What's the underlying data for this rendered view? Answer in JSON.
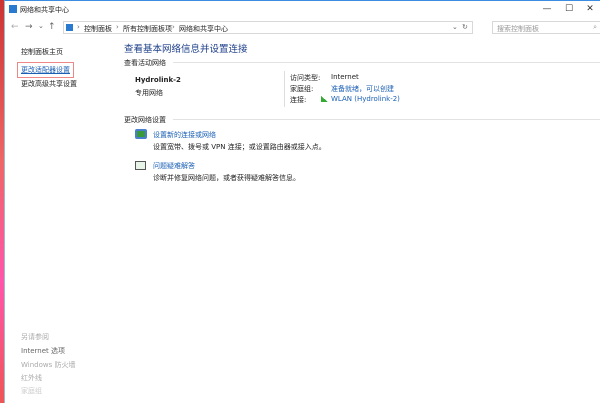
{
  "window": {
    "title": "网络和共享中心",
    "minimize": "—",
    "maximize": "☐",
    "close": "✕"
  },
  "nav": {
    "back": "←",
    "forward": "→",
    "recent": "⌄",
    "up": "↑",
    "refresh": "↻",
    "dropdown": "⌄",
    "breadcrumb": [
      "控制面板",
      "所有控制面板项",
      "网络和共享中心"
    ],
    "sep": "›",
    "search_placeholder": "搜索控制面板",
    "search_icon": "⌕"
  },
  "sidebar": {
    "items": [
      "控制面板主页",
      "更改适配器设置",
      "更改高级共享设置"
    ],
    "see_also_title": "另请参阅",
    "see_also": [
      "Internet 选项",
      "Windows 防火墙",
      "红外线",
      "家庭组"
    ]
  },
  "main": {
    "heading": "查看基本网络信息并设置连接",
    "active_section": "查看活动网络",
    "network": {
      "name": "Hydrolink-2",
      "type": "专用网络",
      "access_label": "访问类型:",
      "access_value": "Internet",
      "homegroup_label": "家庭组:",
      "homegroup_value": "准备就绪，可以创建",
      "conn_label": "连接:",
      "conn_value": "WLAN (Hydrolink-2)"
    },
    "change_section": "更改网络设置",
    "tasks": [
      {
        "link": "设置新的连接或网络",
        "desc": "设置宽带、拨号或 VPN 连接；或设置路由器或接入点。"
      },
      {
        "link": "问题疑难解答",
        "desc": "诊断并修复网络问题，或者获得疑难解答信息。"
      }
    ]
  },
  "colors": {
    "link": "#1a5fb4",
    "highlight_box": "#e88"
  }
}
